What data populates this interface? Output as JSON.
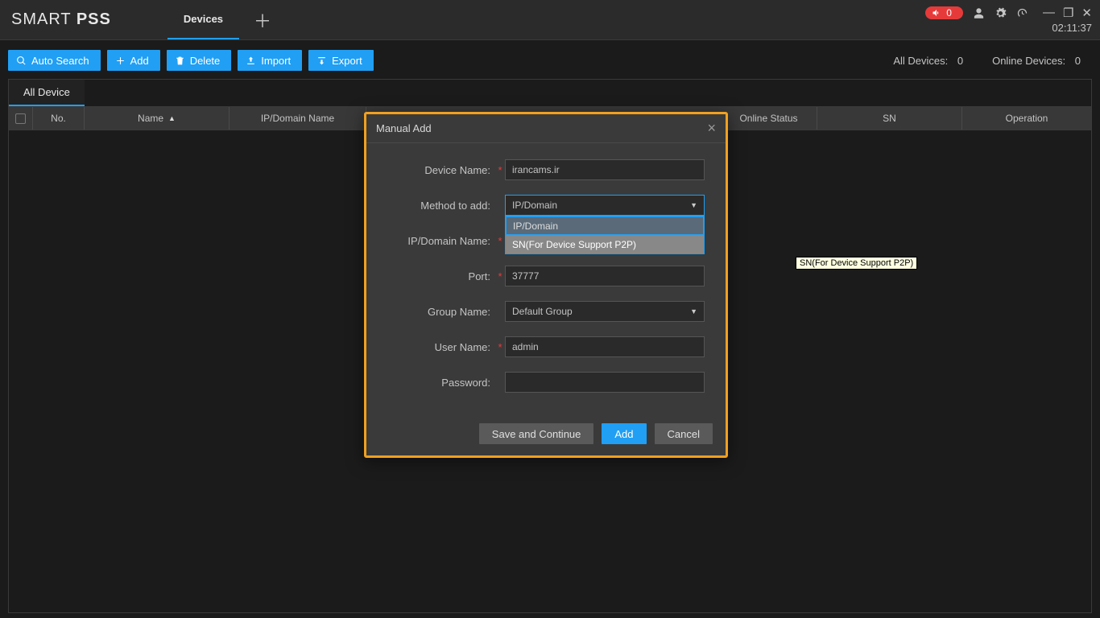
{
  "header": {
    "app_name_1": "SMART",
    "app_name_2": "PSS",
    "tab_active": "Devices",
    "alert_count": "0",
    "clock": "02:11:37"
  },
  "toolbar": {
    "auto_search": "Auto Search",
    "add": "Add",
    "delete": "Delete",
    "import": "Import",
    "export": "Export",
    "all_devices_label": "All Devices:",
    "all_devices_count": "0",
    "online_devices_label": "Online Devices:",
    "online_devices_count": "0"
  },
  "table": {
    "tab_all": "All Device",
    "cols": {
      "no": "No.",
      "name": "Name",
      "ip": "IP/Domain Name",
      "online": "Online Status",
      "sn": "SN",
      "op": "Operation"
    }
  },
  "modal": {
    "title": "Manual Add",
    "labels": {
      "device_name": "Device Name:",
      "method": "Method to add:",
      "ip_domain": "IP/Domain Name:",
      "port": "Port:",
      "group": "Group Name:",
      "user": "User Name:",
      "password": "Password:"
    },
    "values": {
      "device_name": "irancams.ir",
      "method_selected": "IP/Domain",
      "ip_domain": "",
      "port": "37777",
      "group": "Default Group",
      "user": "admin",
      "password": ""
    },
    "dropdown": {
      "opt1": "IP/Domain",
      "opt2": "SN(For Device Support P2P)"
    },
    "tooltip": "SN(For Device Support P2P)",
    "buttons": {
      "save_continue": "Save and Continue",
      "add": "Add",
      "cancel": "Cancel"
    }
  }
}
